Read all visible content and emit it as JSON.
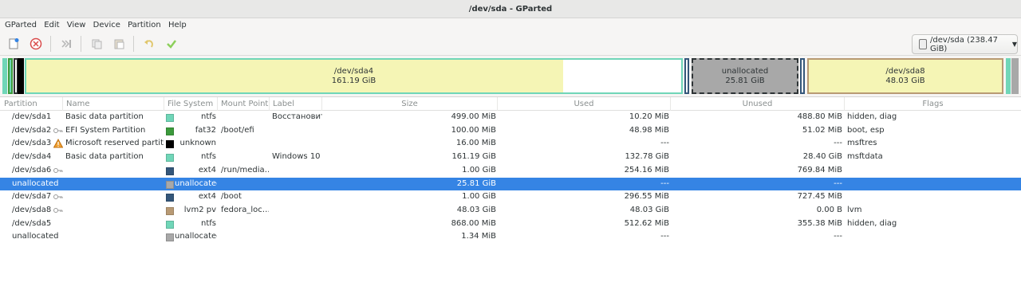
{
  "window": {
    "title": "/dev/sda - GParted"
  },
  "menu": [
    "GParted",
    "Edit",
    "View",
    "Device",
    "Partition",
    "Help"
  ],
  "toolbar": {
    "icons": [
      "new-icon",
      "delete-icon",
      "resize-move-icon",
      "copy-icon",
      "paste-icon",
      "undo-icon",
      "apply-icon"
    ]
  },
  "device_selector": {
    "label": "/dev/sda (238.47 GiB)"
  },
  "map": {
    "sda4": {
      "name": "/dev/sda4",
      "size": "161.19 GiB",
      "used_fraction": 0.82
    },
    "unallocated": {
      "name": "unallocated",
      "size": "25.81 GiB"
    },
    "sda8": {
      "name": "/dev/sda8",
      "size": "48.03 GiB",
      "used_fraction": 1.0
    }
  },
  "columns": {
    "partition": "Partition",
    "name": "Name",
    "filesystem": "File System",
    "mount": "Mount Point",
    "label": "Label",
    "size": "Size",
    "used": "Used",
    "unused": "Unused",
    "flags": "Flags"
  },
  "rows": [
    {
      "partition": "/dev/sda1",
      "name": "Basic data partition",
      "fs": "ntfs",
      "color": "#70d6b8",
      "mount": "",
      "label": "Восстановить",
      "size": "499.00 MiB",
      "used": "10.20 MiB",
      "unused": "488.80 MiB",
      "flags": "hidden, diag",
      "icon": ""
    },
    {
      "partition": "/dev/sda2",
      "name": "EFI System Partition",
      "fs": "fat32",
      "color": "#3c9a3c",
      "mount": "/boot/efi",
      "label": "",
      "size": "100.00 MiB",
      "used": "48.98 MiB",
      "unused": "51.02 MiB",
      "flags": "boot, esp",
      "icon": "key"
    },
    {
      "partition": "/dev/sda3",
      "name": "Microsoft reserved partition",
      "fs": "unknown",
      "color": "#000000",
      "mount": "",
      "label": "",
      "size": "16.00 MiB",
      "used": "---",
      "unused": "---",
      "flags": "msftres",
      "icon": "warn"
    },
    {
      "partition": "/dev/sda4",
      "name": "Basic data partition",
      "fs": "ntfs",
      "color": "#70d6b8",
      "mount": "",
      "label": "Windows 10",
      "size": "161.19 GiB",
      "used": "132.78 GiB",
      "unused": "28.40 GiB",
      "flags": "msftdata",
      "icon": ""
    },
    {
      "partition": "/dev/sda6",
      "name": "",
      "fs": "ext4",
      "color": "#34567a",
      "mount": "/run/media…",
      "label": "",
      "size": "1.00 GiB",
      "used": "254.16 MiB",
      "unused": "769.84 MiB",
      "flags": "",
      "icon": "key"
    },
    {
      "partition": "unallocated",
      "name": "",
      "fs": "unallocated",
      "color": "#a8a8a8",
      "mount": "",
      "label": "",
      "size": "25.81 GiB",
      "used": "---",
      "unused": "---",
      "flags": "",
      "icon": "",
      "selected": true
    },
    {
      "partition": "/dev/sda7",
      "name": "",
      "fs": "ext4",
      "color": "#34567a",
      "mount": "/boot",
      "label": "",
      "size": "1.00 GiB",
      "used": "296.55 MiB",
      "unused": "727.45 MiB",
      "flags": "",
      "icon": "key"
    },
    {
      "partition": "/dev/sda8",
      "name": "",
      "fs": "lvm2 pv",
      "color": "#b89a74",
      "mount": "fedora_loc…",
      "label": "",
      "size": "48.03 GiB",
      "used": "48.03 GiB",
      "unused": "0.00 B",
      "flags": "lvm",
      "icon": "key"
    },
    {
      "partition": "/dev/sda5",
      "name": "",
      "fs": "ntfs",
      "color": "#70d6b8",
      "mount": "",
      "label": "",
      "size": "868.00 MiB",
      "used": "512.62 MiB",
      "unused": "355.38 MiB",
      "flags": "hidden, diag",
      "icon": ""
    },
    {
      "partition": "unallocated",
      "name": "",
      "fs": "unallocated",
      "color": "#a8a8a8",
      "mount": "",
      "label": "",
      "size": "1.34 MiB",
      "used": "---",
      "unused": "---",
      "flags": "",
      "icon": ""
    }
  ],
  "colors": {
    "ntfs": "#70d6b8",
    "fat32": "#3c9a3c",
    "ext4": "#34567a",
    "lvm2": "#b89a74",
    "unallocated": "#a8a8a8",
    "used_fill": "#f5f5b5",
    "selection": "#3584e4"
  }
}
